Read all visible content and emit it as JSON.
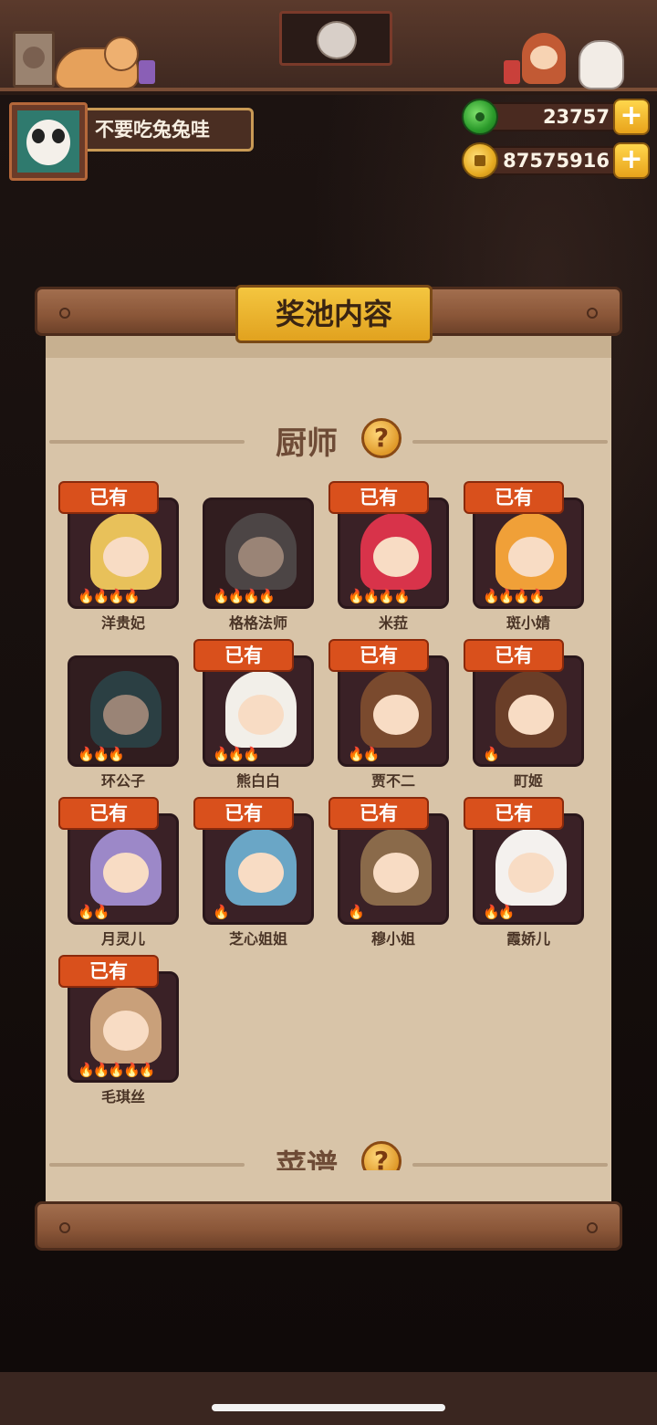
{
  "profile": {
    "name": "不要吃兔兔哇"
  },
  "currency": {
    "jade": "23757",
    "coins": "87575916"
  },
  "panel": {
    "title": "奖池内容"
  },
  "sections": {
    "chefs": "厨师",
    "recipes": "菜谱"
  },
  "owned_label": "已有",
  "chefs": [
    {
      "name": "洋贵妃",
      "owned": true,
      "stars": 4,
      "color": "#e8c15a"
    },
    {
      "name": "格格法师",
      "owned": false,
      "stars": 4,
      "color": "#6a6a6a"
    },
    {
      "name": "米菈",
      "owned": true,
      "stars": 4,
      "color": "#d8334a"
    },
    {
      "name": "斑小婧",
      "owned": true,
      "stars": 4,
      "color": "#f0a038"
    },
    {
      "name": "环公子",
      "owned": false,
      "stars": 3,
      "color": "#2f5f66"
    },
    {
      "name": "熊白白",
      "owned": true,
      "stars": 3,
      "color": "#f2efe9"
    },
    {
      "name": "贾不二",
      "owned": true,
      "stars": 2,
      "color": "#7a4a2e"
    },
    {
      "name": "町姬",
      "owned": true,
      "stars": 1,
      "color": "#6a3e28"
    },
    {
      "name": "月灵儿",
      "owned": true,
      "stars": 2,
      "color": "#9c88c8"
    },
    {
      "name": "芝心姐姐",
      "owned": true,
      "stars": 1,
      "color": "#6aa6c6"
    },
    {
      "name": "穆小姐",
      "owned": true,
      "stars": 1,
      "color": "#8a6a4a"
    },
    {
      "name": "霞娇儿",
      "owned": true,
      "stars": 2,
      "color": "#f4f1ee"
    },
    {
      "name": "毛琪丝",
      "owned": true,
      "stars": 5,
      "color": "#c9a07a"
    }
  ],
  "icons": {
    "jade": "jade-icon",
    "coin": "coin-icon",
    "plus": "plus-icon",
    "help": "question-icon",
    "flame": "flame-icon"
  },
  "colors": {
    "accent": "#e1a21f",
    "owned_tag": "#d9501c",
    "parchment": "#d8c4a8"
  }
}
